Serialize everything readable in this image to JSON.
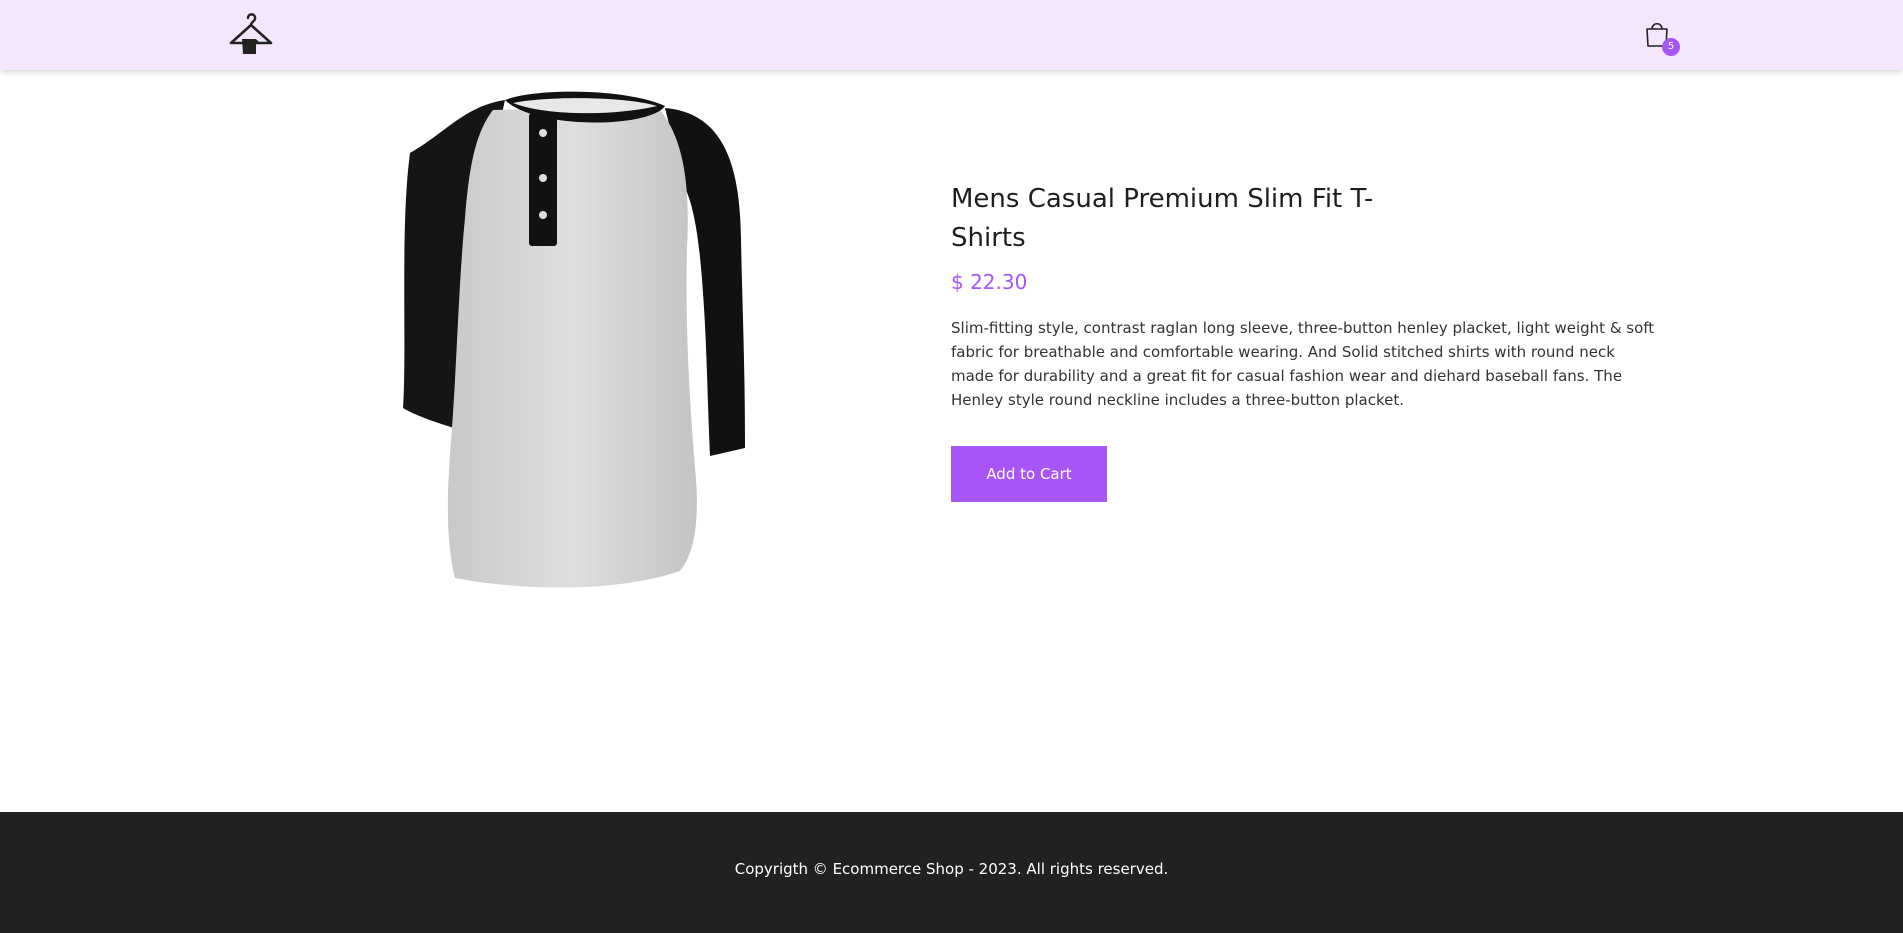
{
  "header": {
    "logo_icon": "hanger-shop-icon",
    "cart_icon": "shopping-bag-icon",
    "cart_count": "5"
  },
  "product": {
    "title": "Mens Casual Premium Slim Fit T-Shirts",
    "price": "$ 22.30",
    "description": "Slim-fitting style, contrast raglan long sleeve, three-button henley placket, light weight & soft fabric for breathable and comfortable wearing. And Solid stitched shirts with round neck made for durability and a great fit for casual fashion wear and diehard baseball fans. The Henley style round neckline includes a three-button placket.",
    "add_to_cart_label": "Add to Cart",
    "image_description": "grey and black raglan henley t-shirt"
  },
  "footer": {
    "copyright": "Copyrigth © Ecommerce Shop - 2023. All rights reserved."
  },
  "colors": {
    "accent": "#a855f7",
    "header_bg": "#f3e6fd",
    "footer_bg": "#212121"
  }
}
